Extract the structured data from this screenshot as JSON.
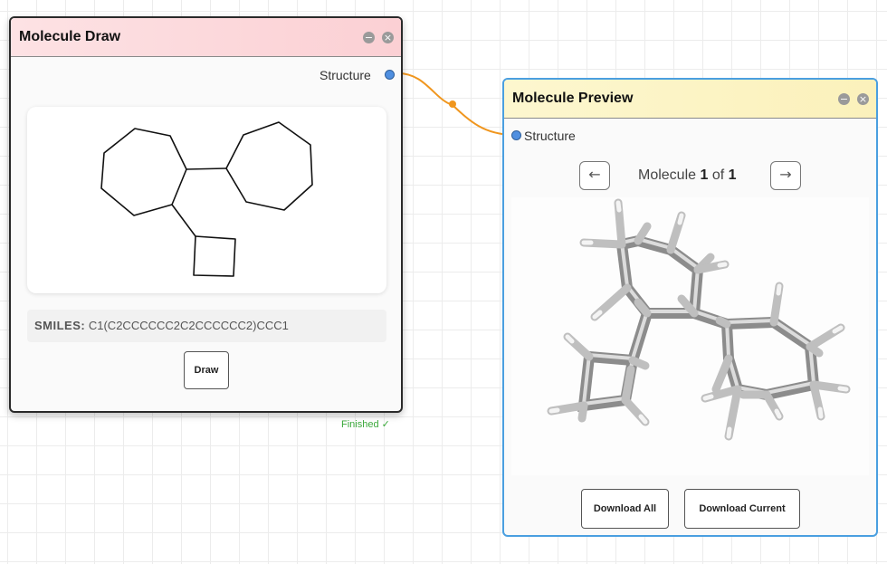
{
  "connection": {
    "color": "#f0961e"
  },
  "draw_node": {
    "title": "Molecule Draw",
    "header_buttons": [
      "minimize-icon",
      "close-icon"
    ],
    "output_port_label": "Structure",
    "smiles_label": "SMILES:",
    "smiles_value": "C1(C2CCCCCC2C2CCCCCC2)CCC1",
    "draw_button": "Draw",
    "status": "Finished ✓",
    "status_color": "#3aa83a",
    "header_color": "#fbd0d4"
  },
  "preview_node": {
    "title": "Molecule Preview",
    "header_buttons": [
      "minimize-icon",
      "close-icon"
    ],
    "input_port_label": "Structure",
    "prev_icon": "←",
    "next_icon": "→",
    "counter_prefix": "Molecule",
    "current": "1",
    "counter_of": "of",
    "total": "1",
    "download_all": "Download All",
    "download_current": "Download Current",
    "header_color": "#fbf1bb",
    "border_color": "#4a9fe0"
  }
}
